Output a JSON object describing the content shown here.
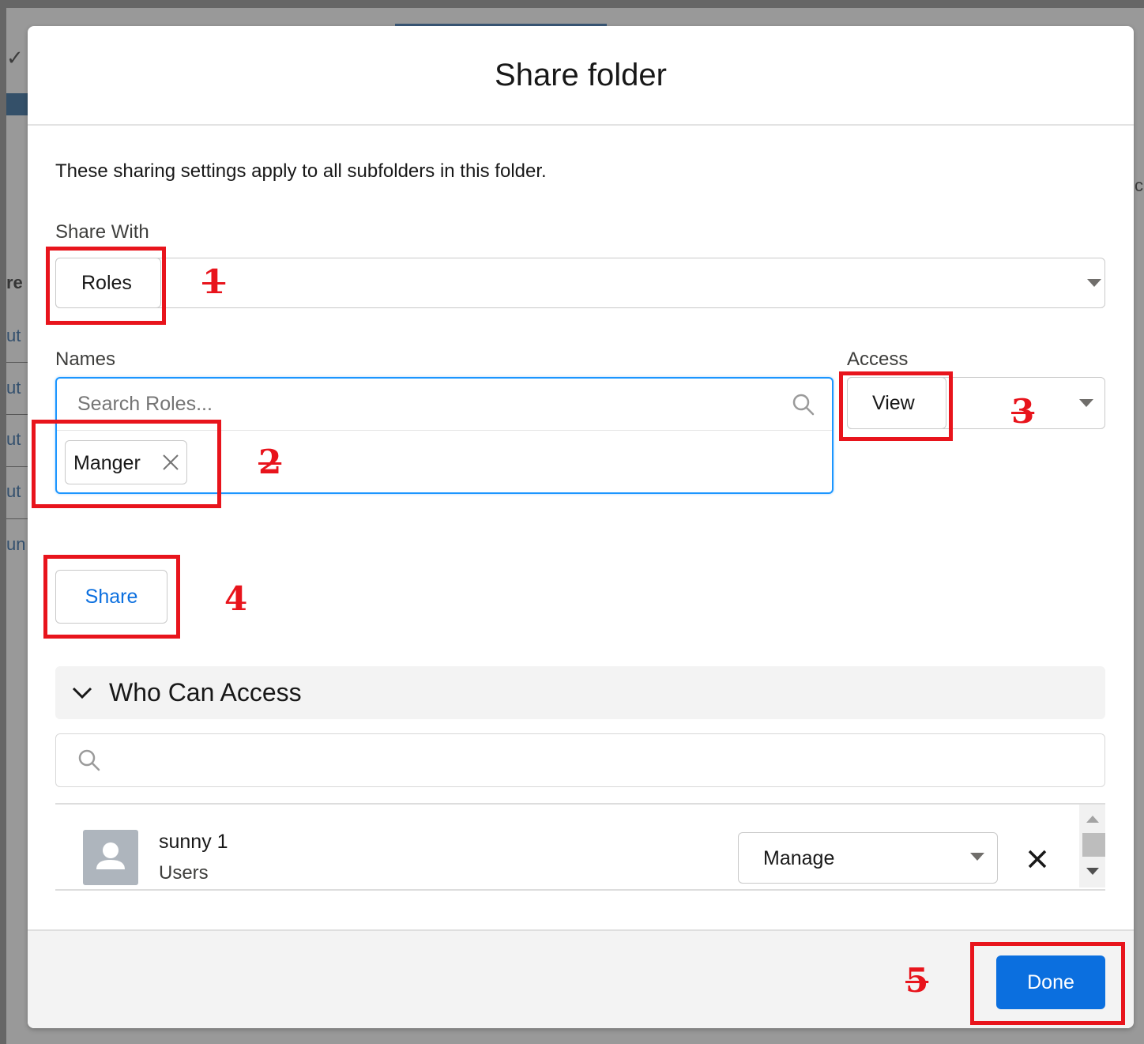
{
  "background": {
    "fragments": [
      "re",
      "ut",
      "ut",
      "ut",
      "ut",
      "un"
    ],
    "right_fragment": "c|"
  },
  "modal": {
    "title": "Share folder",
    "intro": "These sharing settings apply to all subfolders in this folder.",
    "share_with": {
      "label": "Share With",
      "value": "Roles"
    },
    "names": {
      "label": "Names",
      "placeholder": "Search Roles...",
      "selected_pill": "Manger"
    },
    "access": {
      "label": "Access",
      "value": "View"
    },
    "share_button": "Share",
    "who_can_access": {
      "title": "Who Can Access",
      "rows": [
        {
          "name": "sunny 1",
          "type": "Users",
          "access": "Manage"
        }
      ]
    },
    "done_button": "Done"
  },
  "annotations": {
    "numbers": [
      "1",
      "2",
      "3",
      "4",
      "5"
    ],
    "color": "#e8141c"
  },
  "colors": {
    "brand": "#0b6fdf",
    "focus": "#1b96ff"
  }
}
